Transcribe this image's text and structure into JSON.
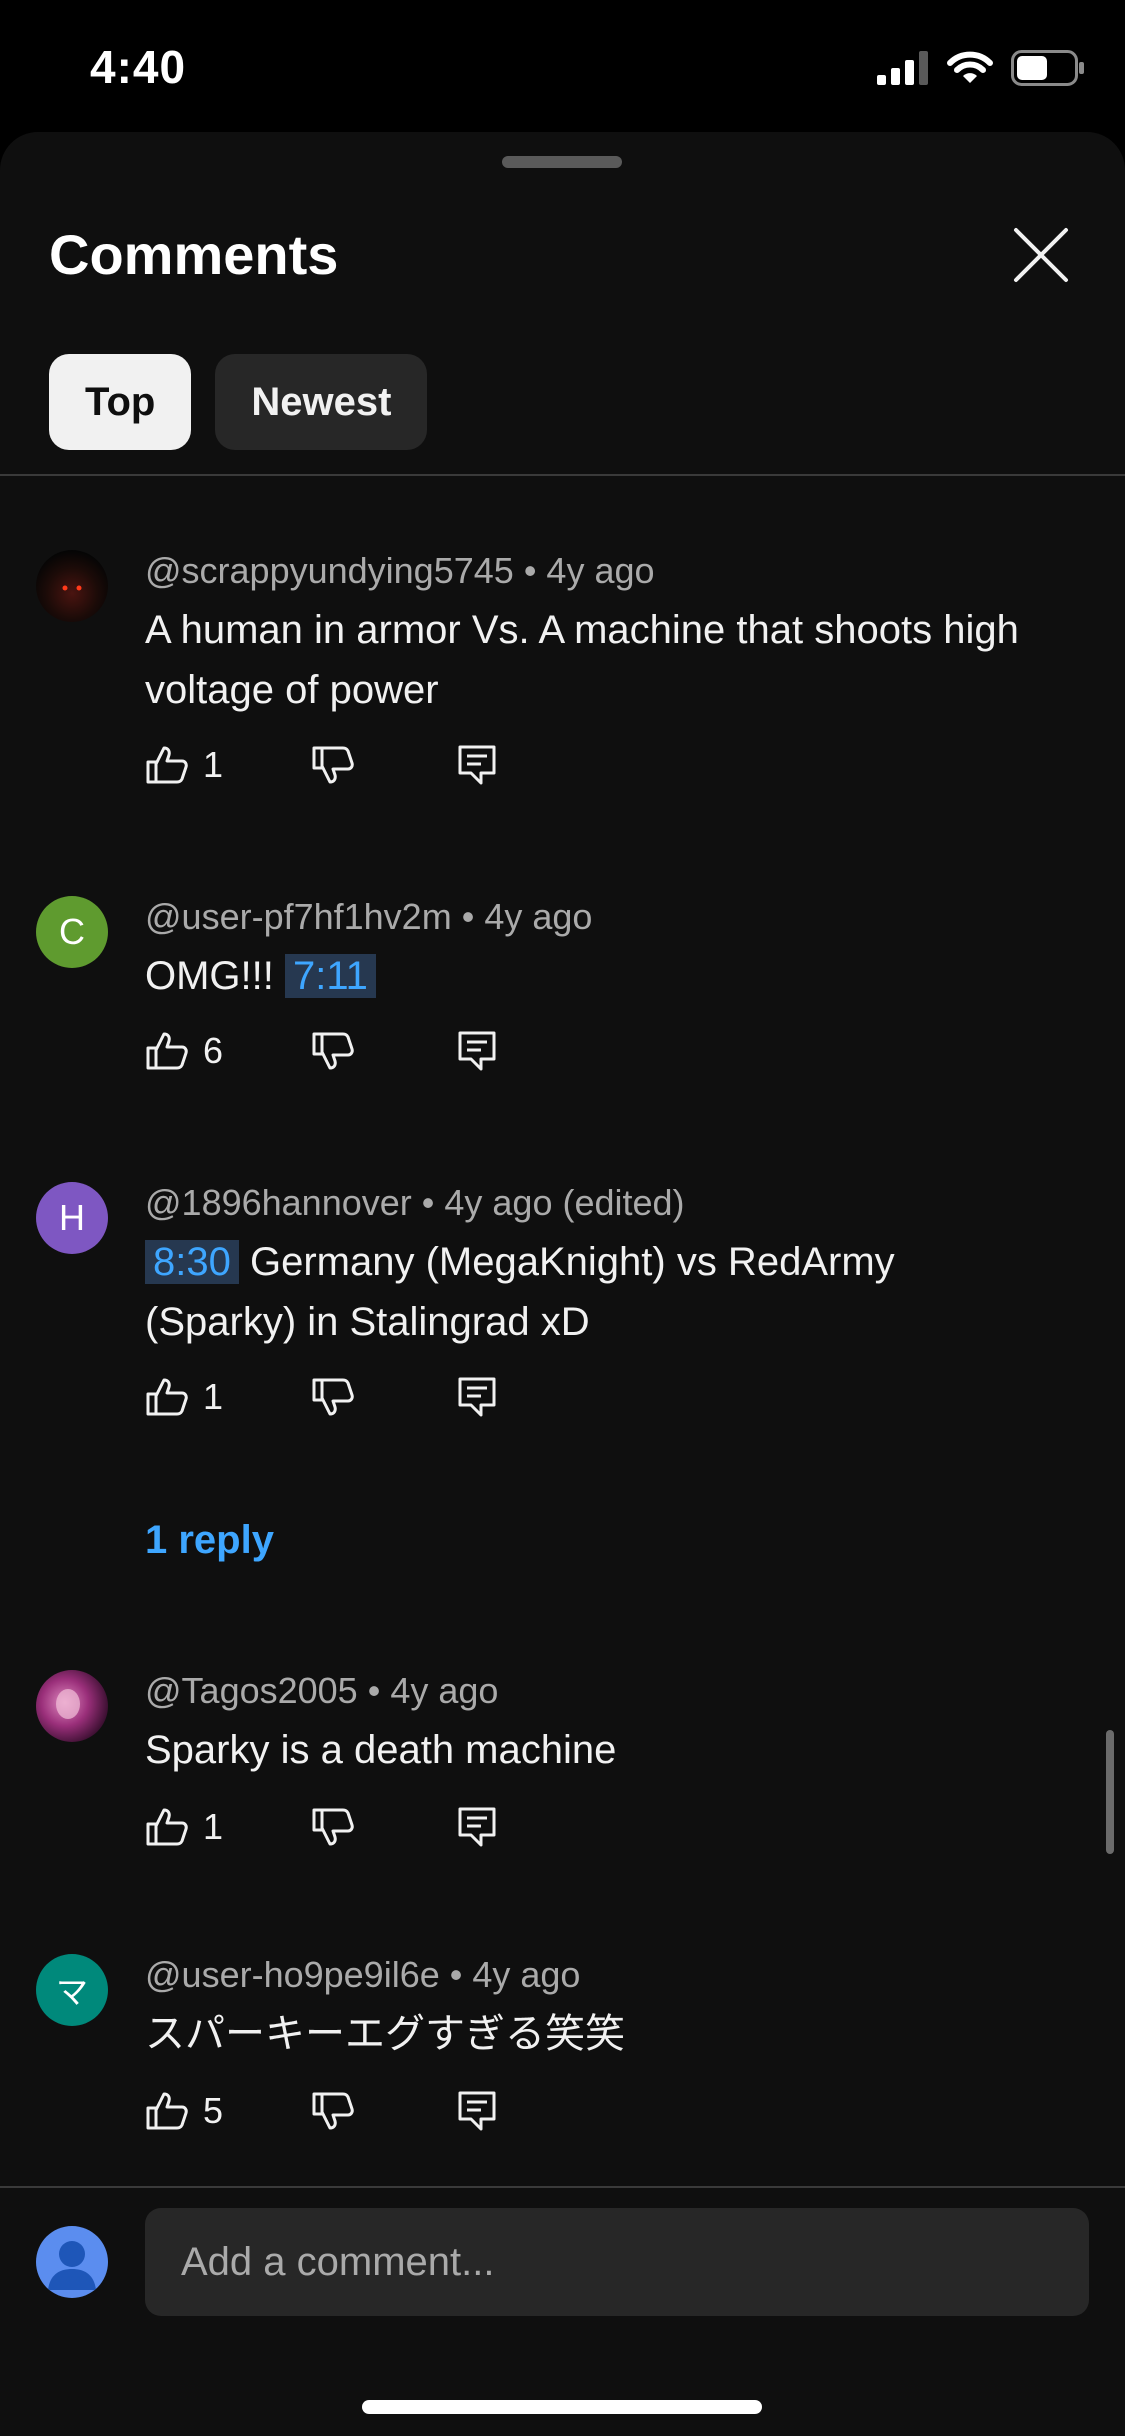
{
  "status_bar": {
    "time": "4:40"
  },
  "header": {
    "title": "Comments"
  },
  "tabs": [
    {
      "label": "Top",
      "active": true
    },
    {
      "label": "Newest",
      "active": false
    }
  ],
  "comments": [
    {
      "author": "@scrappyundying5745",
      "age": "4y ago",
      "text": "A human in armor Vs. A machine that shoots high voltage of power",
      "likes": "1"
    },
    {
      "author": "@user-pf7hf1hv2m",
      "age": "4y ago",
      "avatar_letter": "C",
      "avatar_color": "#5f9b2f",
      "text_before": "OMG!!!",
      "timestamp": "7:11",
      "likes": "6"
    },
    {
      "author": "@1896hannover",
      "age": "4y ago (edited)",
      "avatar_letter": "H",
      "avatar_color": "#7e57c2",
      "timestamp": "8:30",
      "text_after": "Germany (MegaKnight) vs RedArmy (Sparky) in Stalingrad xD",
      "likes": "1",
      "replies_label": "1 reply"
    },
    {
      "author": "@Tagos2005",
      "age": "4y ago",
      "text": "Sparky is a death machine",
      "likes": "1"
    },
    {
      "author": "@user-ho9pe9il6e",
      "age": "4y ago",
      "avatar_letter": "マ",
      "avatar_color": "#00897b",
      "text": "スパーキーエグすぎる笑笑",
      "likes": "5"
    }
  ],
  "composer": {
    "placeholder": "Add a comment..."
  },
  "colors": {
    "accent": "#3ea6ff",
    "background": "#0f0f0f",
    "chip_active": "#f1f1f1",
    "chip_inactive": "#272727"
  }
}
